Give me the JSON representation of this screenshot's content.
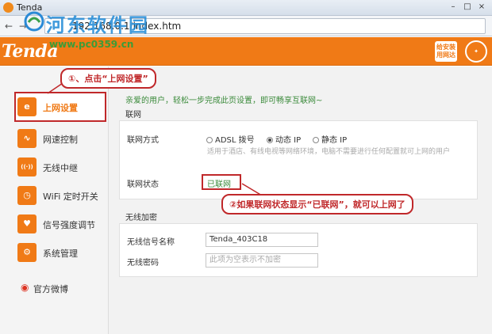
{
  "browser": {
    "tab_title": "Tenda",
    "url_prefix": "192.168.0.1",
    "url_suffix": "index.htm",
    "window_buttons": [
      "–",
      "□",
      "×"
    ]
  },
  "watermark": {
    "text": "河东软件园",
    "url": "www.pc0359.cn"
  },
  "header": {
    "logo": "Tenda",
    "badge_line1": "给安装",
    "badge_line2": "用网达"
  },
  "sidebar": {
    "items": [
      {
        "label": "上网设置",
        "icon": "e-icon",
        "glyph": "e"
      },
      {
        "label": "网速控制",
        "icon": "speed-wave-icon",
        "glyph": "∿"
      },
      {
        "label": "无线中继",
        "icon": "wireless-repeater-icon",
        "glyph": "((·))"
      },
      {
        "label": "WiFi 定时开关",
        "icon": "wifi-timer-icon",
        "glyph": "◷"
      },
      {
        "label": "信号强度调节",
        "icon": "signal-strength-icon",
        "glyph": "♥"
      },
      {
        "label": "系统管理",
        "icon": "gear-icon",
        "glyph": "⚙"
      }
    ],
    "weibo_label": "官方微博"
  },
  "callouts": {
    "step1": "①、点击“上网设置”",
    "step2": "②如果联网状态显示“已联网”，就可以上网了"
  },
  "main": {
    "intro": "亲爱的用户，轻松一步完成此页设置，即可畅享互联网~",
    "network_section": "联网",
    "connection_type_label": "联网方式",
    "connection_options": [
      "ADSL 拨号",
      "动态 IP",
      "静态 IP"
    ],
    "connection_selected": "动态 IP",
    "hint": "适用于酒店、有线电视等网络环境，电脑不需要进行任何配置就可上网的用户",
    "status_label": "联网状态",
    "status_value": "已联网",
    "wireless_section": "无线加密",
    "ssid_label": "无线信号名称",
    "ssid_value": "Tenda_403C18",
    "password_label": "无线密码",
    "password_placeholder": "此项为空表示不加密"
  },
  "colors": {
    "brand_orange": "#f07a16",
    "annotation_red": "#c0282a",
    "status_green": "#3a8a3a"
  }
}
